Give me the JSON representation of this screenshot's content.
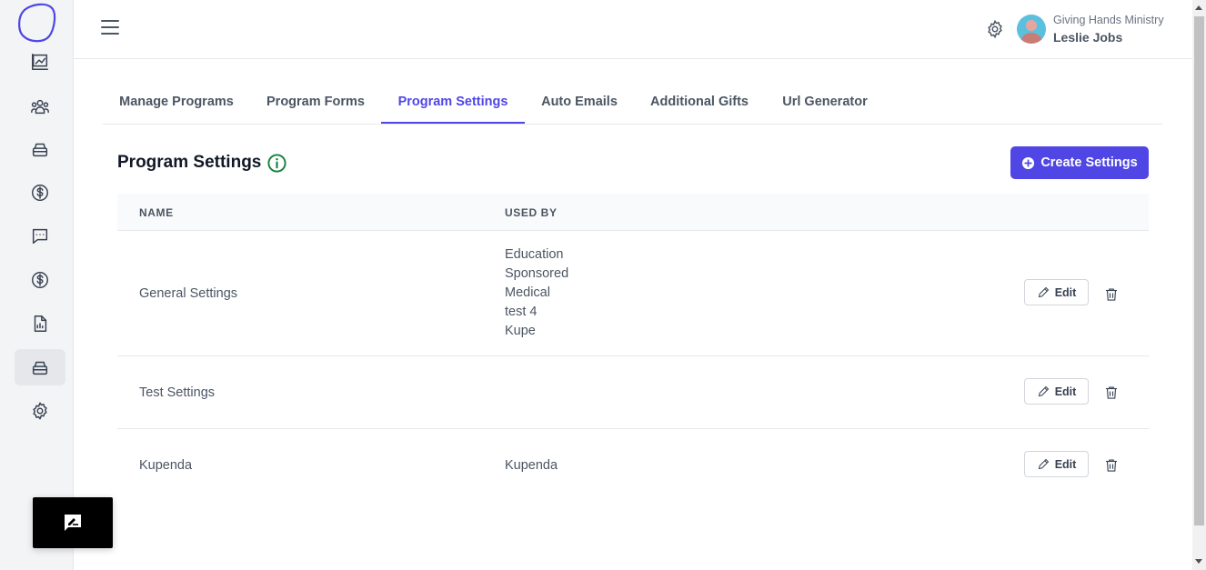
{
  "header": {
    "org_name": "Giving Hands Ministry",
    "user_name": "Leslie Jobs"
  },
  "sidebar": {
    "items": [
      {
        "icon": "chart-line-icon"
      },
      {
        "icon": "users-icon"
      },
      {
        "icon": "inbox-stack-icon"
      },
      {
        "icon": "dollar-circle-icon"
      },
      {
        "icon": "chat-bubble-icon"
      },
      {
        "icon": "dollar-circle-icon"
      },
      {
        "icon": "report-icon"
      },
      {
        "icon": "inbox-stack-icon",
        "active": true
      },
      {
        "icon": "gear-icon"
      }
    ]
  },
  "tabs": [
    {
      "label": "Manage Programs"
    },
    {
      "label": "Program Forms"
    },
    {
      "label": "Program Settings",
      "active": true
    },
    {
      "label": "Auto Emails"
    },
    {
      "label": "Additional Gifts"
    },
    {
      "label": "Url Generator"
    }
  ],
  "page": {
    "title": "Program Settings",
    "create_button": "Create Settings"
  },
  "table": {
    "headers": [
      "NAME",
      "USED BY"
    ],
    "rows": [
      {
        "name": "General Settings",
        "used_by": [
          "Education",
          "Sponsored",
          "Medical",
          "test 4",
          "Kupe"
        ],
        "edit_label": "Edit"
      },
      {
        "name": "Test Settings",
        "used_by": [],
        "edit_label": "Edit"
      },
      {
        "name": "Kupenda",
        "used_by": [
          "Kupenda"
        ],
        "edit_label": "Edit"
      }
    ]
  },
  "colors": {
    "accent": "#4f46e5",
    "info_icon": "#15803d"
  }
}
